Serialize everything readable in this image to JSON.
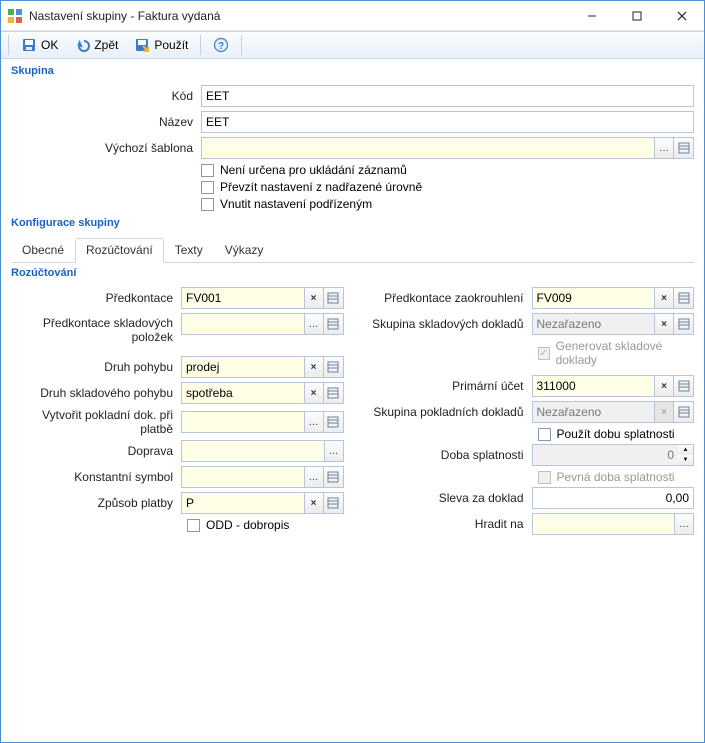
{
  "window": {
    "title": "Nastavení skupiny - Faktura vydaná"
  },
  "toolbar": {
    "ok": "OK",
    "zpet": "Zpět",
    "pouzit": "Použít"
  },
  "skupina": {
    "legend": "Skupina",
    "kod_label": "Kód",
    "kod": "EET",
    "nazev_label": "Název",
    "nazev": "EET",
    "sablona_label": "Výchozí šablona",
    "sablona": "",
    "chk1": "Není určena pro ukládání záznamů",
    "chk2": "Převzít nastavení z nadřazené úrovně",
    "chk3": "Vnutit nastavení podřízeným"
  },
  "konfig": {
    "legend": "Konfigurace skupiny",
    "tabs": [
      "Obecné",
      "Rozúčtování",
      "Texty",
      "Výkazy"
    ],
    "sub_legend": "Rozúčtování",
    "left": {
      "predkontace_label": "Předkontace",
      "predkontace": "FV001",
      "predkontace_sklad_label": "Předkontace skladových položek",
      "predkontace_sklad": "",
      "druh_pohybu_label": "Druh pohybu",
      "druh_pohybu": "prodej",
      "druh_sklad_pohybu_label": "Druh skladového pohybu",
      "druh_sklad_pohybu": "spotřeba",
      "vytvorit_label": "Vytvořit pokladní dok. při platbě",
      "vytvorit": "",
      "doprava_label": "Doprava",
      "doprava": "",
      "konst_sym_label": "Konstantní symbol",
      "konst_sym": "",
      "zpusob_label": "Způsob platby",
      "zpusob": "P",
      "odd_label": "ODD - dobropis"
    },
    "right": {
      "predkontace_zaok_label": "Předkontace zaokrouhlení",
      "predkontace_zaok": "FV009",
      "skupina_sklad_label": "Skupina skladových dokladů",
      "skupina_sklad": "Nezařazeno",
      "gen_sklad_label": "Generovat skladové doklady",
      "primarni_label": "Primární účet",
      "primarni": "311000",
      "skupina_pokl_label": "Skupina pokladních dokladů",
      "skupina_pokl": "Nezařazeno",
      "pouzit_splat_label": "Použít dobu splatnosti",
      "doba_splat_label": "Doba splatnosti",
      "doba_splat": "0",
      "pevna_doba_label": "Pevná doba splatnosti",
      "sleva_label": "Sleva za doklad",
      "sleva": "0,00",
      "hradit_label": "Hradit na",
      "hradit": ""
    }
  }
}
